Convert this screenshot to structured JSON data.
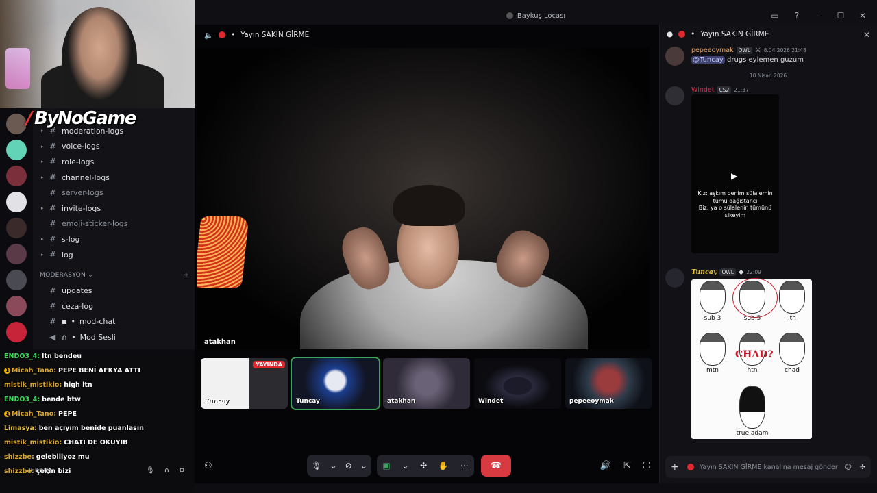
{
  "window": {
    "title": "Baykuş Locası",
    "controls": [
      "▭",
      "?",
      "–",
      "☐",
      "✕"
    ]
  },
  "stream_overlay": {
    "logo_text": "ByNoGame"
  },
  "sidebar": {
    "channels": [
      {
        "label": "moderation-logs",
        "dim": false
      },
      {
        "label": "voice-logs",
        "dim": false
      },
      {
        "label": "role-logs",
        "dim": false
      },
      {
        "label": "channel-logs",
        "dim": false
      },
      {
        "label": "server-logs",
        "dim": true
      },
      {
        "label": "invite-logs",
        "dim": false
      },
      {
        "label": "emoji-sticker-logs",
        "dim": true
      },
      {
        "label": "s-log",
        "dim": false
      },
      {
        "label": "log",
        "dim": false
      }
    ],
    "category": "MODERASYON",
    "mod_channels": [
      {
        "label": "updates"
      },
      {
        "label": "ceza-log"
      },
      {
        "label": "mod-chat"
      },
      {
        "label": "Mod Sesli"
      }
    ]
  },
  "stream_chat": [
    {
      "user": "ENDO3_4:",
      "text": "ltn bendeu",
      "color": "#3ddc5a",
      "badge": false
    },
    {
      "user": "Micah_Tano:",
      "text": "PEPE BENİ AFKYA ATTI",
      "color": "#d9a62f",
      "badge": true
    },
    {
      "user": "mistik_mistikio:",
      "text": "high ltn",
      "color": "#d9a62f",
      "badge": false
    },
    {
      "user": "ENDO3_4:",
      "text": "bende btw",
      "color": "#3ddc5a",
      "badge": false
    },
    {
      "user": "Micah_Tano:",
      "text": "PEPE",
      "color": "#d9a62f",
      "badge": true
    },
    {
      "user": "Limasya:",
      "text": "ben açıyım benide puanlasın",
      "color": "#e8c23d",
      "badge": false
    },
    {
      "user": "mistik_mistikio:",
      "text": "CHATI DE OKUYIB",
      "color": "#d9a62f",
      "badge": false
    },
    {
      "user": "shizzbe:",
      "text": "gelebiliyoz mu",
      "color": "#d9a62f",
      "badge": false
    },
    {
      "user": "shizzbe:",
      "text": "çekin bizi",
      "color": "#d9a62f",
      "badge": false
    }
  ],
  "voice": {
    "channel": "Yayın SAKIN GİRME",
    "main_video_name": "atakhan"
  },
  "participants": [
    {
      "name": "Tuncay",
      "live": true,
      "live_label": "YAYINDA"
    },
    {
      "name": "Tuncay",
      "live": false,
      "live_label": ""
    },
    {
      "name": "atakhan",
      "live": false,
      "live_label": ""
    },
    {
      "name": "Windet",
      "live": false,
      "live_label": ""
    },
    {
      "name": "pepeeoymak",
      "live": false,
      "live_label": ""
    }
  ],
  "chat": {
    "header": "Yayın SAKIN GİRME",
    "messages": [
      {
        "user": "pepeeoymak",
        "user_color": "#e8a25c",
        "tag": "OWL",
        "time": "8.04.2026 21:48",
        "mention": "@Tuncay",
        "text": "drugs eylemen guzum"
      },
      {
        "user": "Windet",
        "user_color": "#c8324b",
        "tag": "CS2",
        "time": "21:37",
        "video_caption": "Kız: aşkım benim sülalemin tümü dağıstancı\nBiz: ya o sülalenin tümünü sikeyim"
      },
      {
        "user": "Tuncay",
        "user_color": "#e5c244",
        "tag": "OWL",
        "time": "22:09",
        "image_labels": [
          "sub 3",
          "sub 5",
          "ltn",
          "mtn",
          "htn",
          "chad",
          "true adam"
        ],
        "image_overlay": "CHAD?"
      }
    ],
    "day_divider": "10 Nisan 2026",
    "composer_placeholder": "Yayın SAKIN GİRME kanalına mesaj gönder"
  },
  "colors": {
    "accent_red": "#d83a42",
    "live_green": "#3ba55d"
  }
}
